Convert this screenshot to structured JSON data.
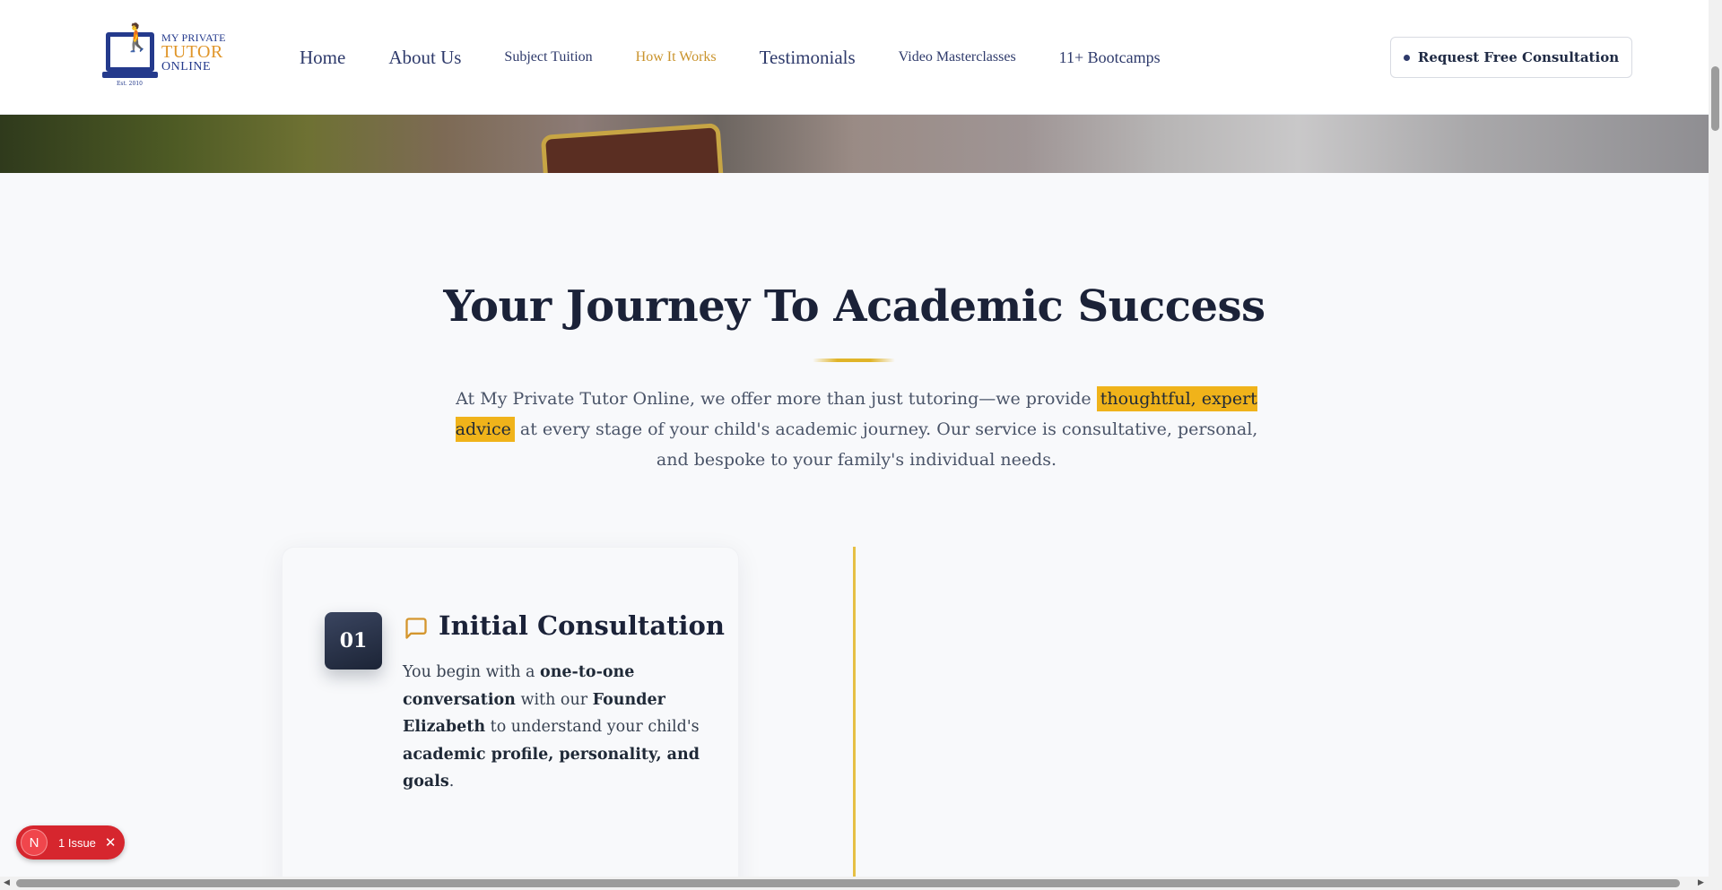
{
  "header": {
    "logo": {
      "line1": "MY PRIVATE",
      "line2": "TUTOR",
      "line3": "ONLINE",
      "est": "Est. 2010"
    },
    "nav": [
      {
        "label": "Home"
      },
      {
        "label": "About Us"
      },
      {
        "label": "Subject Tuition"
      },
      {
        "label": "How It Works"
      },
      {
        "label": "Testimonials"
      },
      {
        "label": "Video Masterclasses"
      },
      {
        "label": "11+ Bootcamps"
      }
    ],
    "cta_label": "Request Free Consultation"
  },
  "section": {
    "title": "Your Journey To Academic Success",
    "intro_before": "At My Private Tutor Online, we offer more than just tutoring—we provide ",
    "intro_highlight": "thoughtful, expert advice",
    "intro_after": " at every stage of your child's academic journey. Our service is consultative, personal, and bespoke to your family's individual needs."
  },
  "steps": [
    {
      "number": "01",
      "icon": "chat-bubble-icon",
      "title": "Initial Consultation",
      "text_parts": [
        "You begin with a ",
        "one-to-one conversation",
        " with our ",
        "Founder Elizabeth",
        " to understand your child's ",
        "academic profile, personality, and goals",
        "."
      ]
    }
  ],
  "issue_badge": {
    "initial": "N",
    "label": "1 Issue"
  },
  "colors": {
    "navy": "#1b2238",
    "gold": "#e0b428",
    "nav_active": "#c9932c",
    "highlight": "#f0b31a"
  }
}
